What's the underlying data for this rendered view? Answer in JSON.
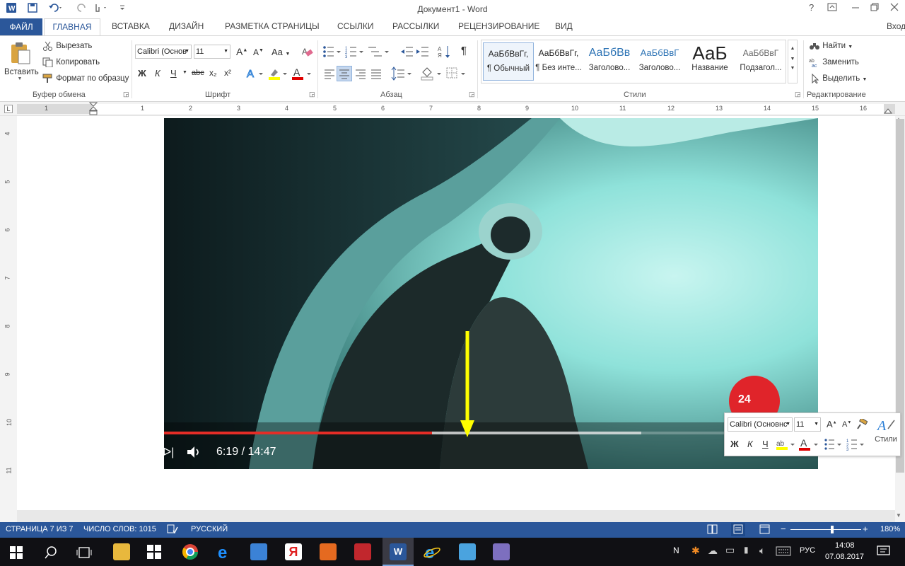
{
  "window": {
    "title": "Документ1 - Word",
    "help": "?",
    "signin": "Вход"
  },
  "tabs": {
    "file": "ФАЙЛ",
    "home": "ГЛАВНАЯ",
    "insert": "ВСТАВКА",
    "design": "ДИЗАЙН",
    "layout": "РАЗМЕТКА СТРАНИЦЫ",
    "references": "ССЫЛКИ",
    "mailings": "РАССЫЛКИ",
    "review": "РЕЦЕНЗИРОВАНИЕ",
    "view": "ВИД"
  },
  "clipboard": {
    "paste": "Вставить",
    "cut": "Вырезать",
    "copy": "Копировать",
    "format_painter": "Формат по образцу",
    "label": "Буфер обмена"
  },
  "font": {
    "name": "Calibri (Основ",
    "size": "11",
    "label": "Шрифт",
    "bold": "Ж",
    "italic": "К",
    "underline": "Ч",
    "strike": "abc",
    "sub": "x₂",
    "sup": "x²",
    "case": "Aa",
    "color_letter": "A"
  },
  "paragraph": {
    "label": "Абзац",
    "pilcrow": "¶"
  },
  "styles": {
    "label": "Стили",
    "items": [
      {
        "sample": "АаБбВвГг,",
        "name": "¶ Обычный"
      },
      {
        "sample": "АаБбВвГг,",
        "name": "¶ Без инте..."
      },
      {
        "sample": "АаБбВв",
        "name": "Заголово..."
      },
      {
        "sample": "АаБбВвГ",
        "name": "Заголово..."
      },
      {
        "sample": "АаБ",
        "name": "Название"
      },
      {
        "sample": "АаБбВвГ",
        "name": "Подзагол..."
      }
    ]
  },
  "editing": {
    "find": "Найти",
    "replace": "Заменить",
    "select": "Выделить",
    "label": "Редактирование"
  },
  "ruler": {
    "h": [
      "1",
      "1",
      "2",
      "3",
      "4",
      "5",
      "6",
      "7",
      "8",
      "9",
      "10",
      "11",
      "12",
      "13",
      "14",
      "15",
      "16"
    ],
    "v": [
      "4",
      "5",
      "6",
      "7",
      "8",
      "9",
      "10",
      "11"
    ]
  },
  "video": {
    "time": "6:19 / 14:47",
    "progress": 0.41,
    "buffered": 0.73,
    "badge": "24"
  },
  "minibar": {
    "font": "Calibri (Основнс",
    "size": "11",
    "bold": "Ж",
    "italic": "К",
    "underline": "Ч",
    "styles": "Стили"
  },
  "status": {
    "page": "СТРАНИЦА 7 ИЗ 7",
    "words": "ЧИСЛО СЛОВ: 1015",
    "lang": "РУССКИЙ",
    "zoom": "180%"
  },
  "taskbar": {
    "clock_time": "14:08",
    "clock_date": "07.08.2017",
    "input_lang": "РУС"
  },
  "colors": {
    "word_blue": "#2b579a",
    "progress_red": "#e52d27",
    "arrow_yellow": "#ffff00"
  }
}
